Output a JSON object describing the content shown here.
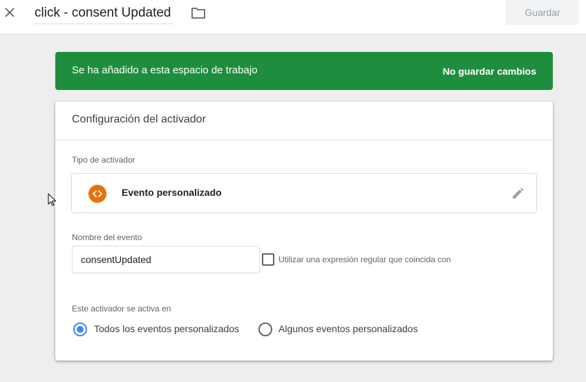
{
  "header": {
    "title": "click - consent Updated",
    "save_label": "Guardar"
  },
  "banner": {
    "message": "Se ha añadido a esta espacio de trabajo",
    "action_label": "No guardar cambios",
    "color": "#1e8e3e"
  },
  "trigger_config": {
    "section_title": "Configuración del activador",
    "trigger_type_label": "Tipo de activador",
    "trigger_type_value": "Evento personalizado",
    "trigger_type_icon": "custom-event-icon",
    "trigger_icon_color": "#e8710a",
    "event_name_label": "Nombre del evento",
    "event_name_value": "consentUpdated",
    "regex_checkbox_label": "Utilizar una expresión regular que coincida con",
    "regex_checked": false,
    "fires_on_label": "Este activador se activa en",
    "fires_on_options": [
      {
        "label": "Todos los eventos personalizados",
        "selected": true
      },
      {
        "label": "Algunos eventos personalizados",
        "selected": false
      }
    ]
  }
}
